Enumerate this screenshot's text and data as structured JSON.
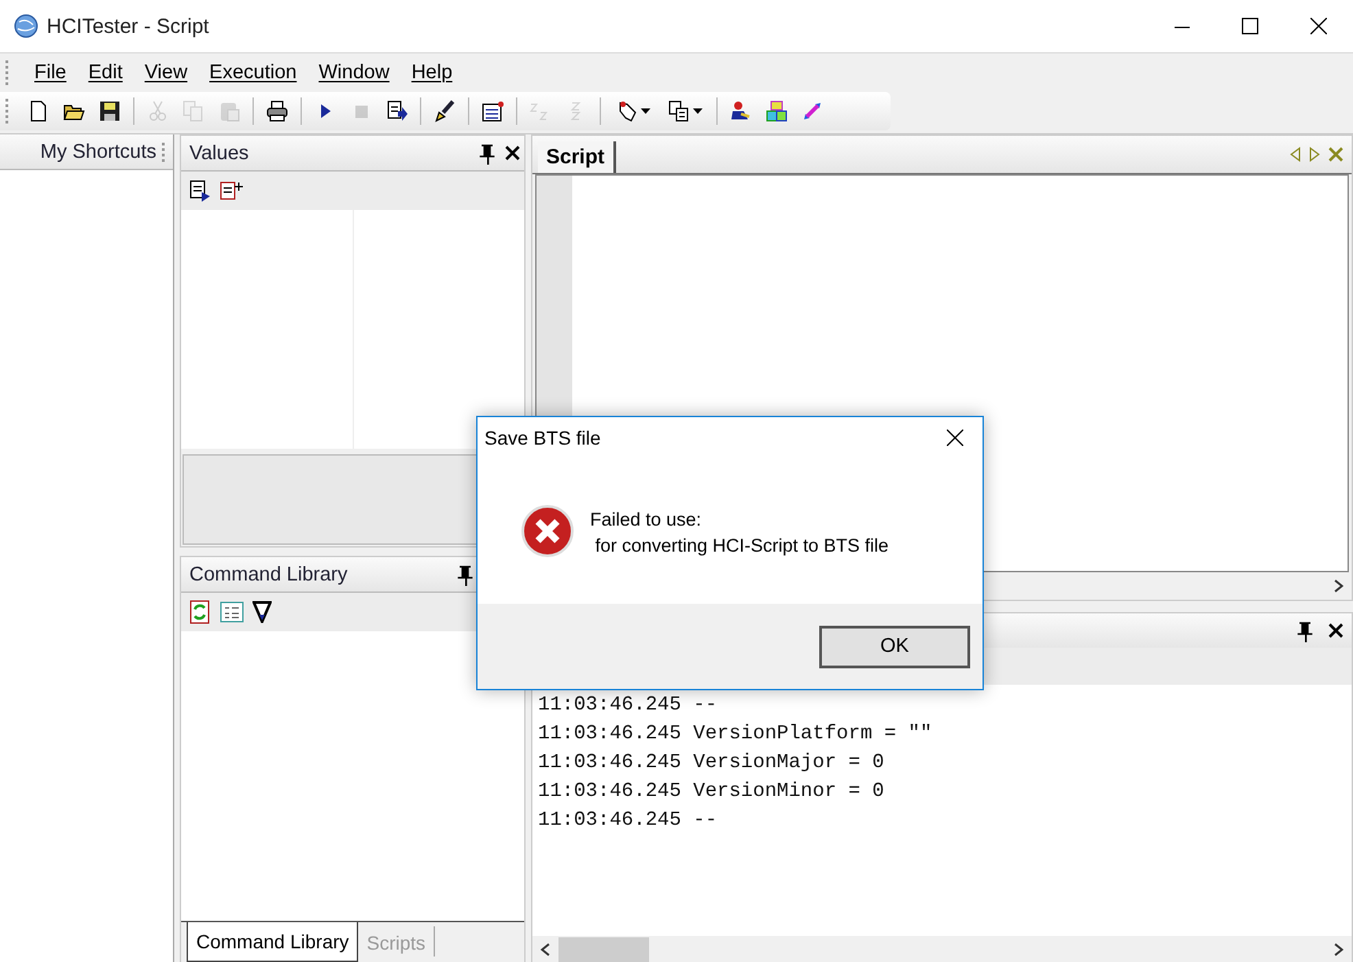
{
  "window": {
    "title": "HCITester - Script"
  },
  "menu": [
    "File",
    "Edit",
    "View",
    "Execution",
    "Window",
    "Help"
  ],
  "toolbar": [
    {
      "kind": "button",
      "disabled": false
    },
    {
      "kind": "button",
      "disabled": false
    },
    {
      "kind": "button",
      "disabled": false
    },
    {
      "kind": "separator"
    },
    {
      "kind": "button",
      "disabled": true
    },
    {
      "kind": "button",
      "disabled": true
    },
    {
      "kind": "button",
      "disabled": true
    },
    {
      "kind": "separator"
    },
    {
      "kind": "button",
      "disabled": false
    },
    {
      "kind": "separator"
    },
    {
      "kind": "button",
      "disabled": false
    },
    {
      "kind": "button",
      "disabled": true
    },
    {
      "kind": "button",
      "disabled": false
    },
    {
      "kind": "separator"
    },
    {
      "kind": "button",
      "disabled": false
    },
    {
      "kind": "separator"
    },
    {
      "kind": "button",
      "disabled": false
    },
    {
      "kind": "separator"
    },
    {
      "kind": "button",
      "disabled": true
    },
    {
      "kind": "button",
      "disabled": true
    },
    {
      "kind": "separator"
    },
    {
      "kind": "dropdown",
      "disabled": false
    },
    {
      "kind": "dropdown",
      "disabled": false
    },
    {
      "kind": "separator"
    },
    {
      "kind": "button",
      "disabled": false
    },
    {
      "kind": "button",
      "disabled": false
    },
    {
      "kind": "button",
      "disabled": false
    }
  ],
  "shortcuts": {
    "title": "My Shortcuts"
  },
  "values": {
    "title": "Values"
  },
  "command_library": {
    "title": "Command Library",
    "tabs": [
      {
        "label": "Command Library",
        "selected": true
      },
      {
        "label": "Scripts",
        "selected": false
      }
    ]
  },
  "script": {
    "tabs": [
      {
        "label": "Script",
        "selected": true
      }
    ]
  },
  "output": {
    "lines": [
      "11:03:46.245 --",
      "11:03:46.245 VersionPlatform = \"\"",
      "11:03:46.245 VersionMajor = 0",
      "11:03:46.245 VersionMinor = 0",
      "11:03:46.245 --"
    ]
  },
  "dialog": {
    "title": "Save BTS file",
    "message": [
      "Failed to use:",
      " for converting HCI-Script to BTS file"
    ],
    "button": "OK"
  }
}
